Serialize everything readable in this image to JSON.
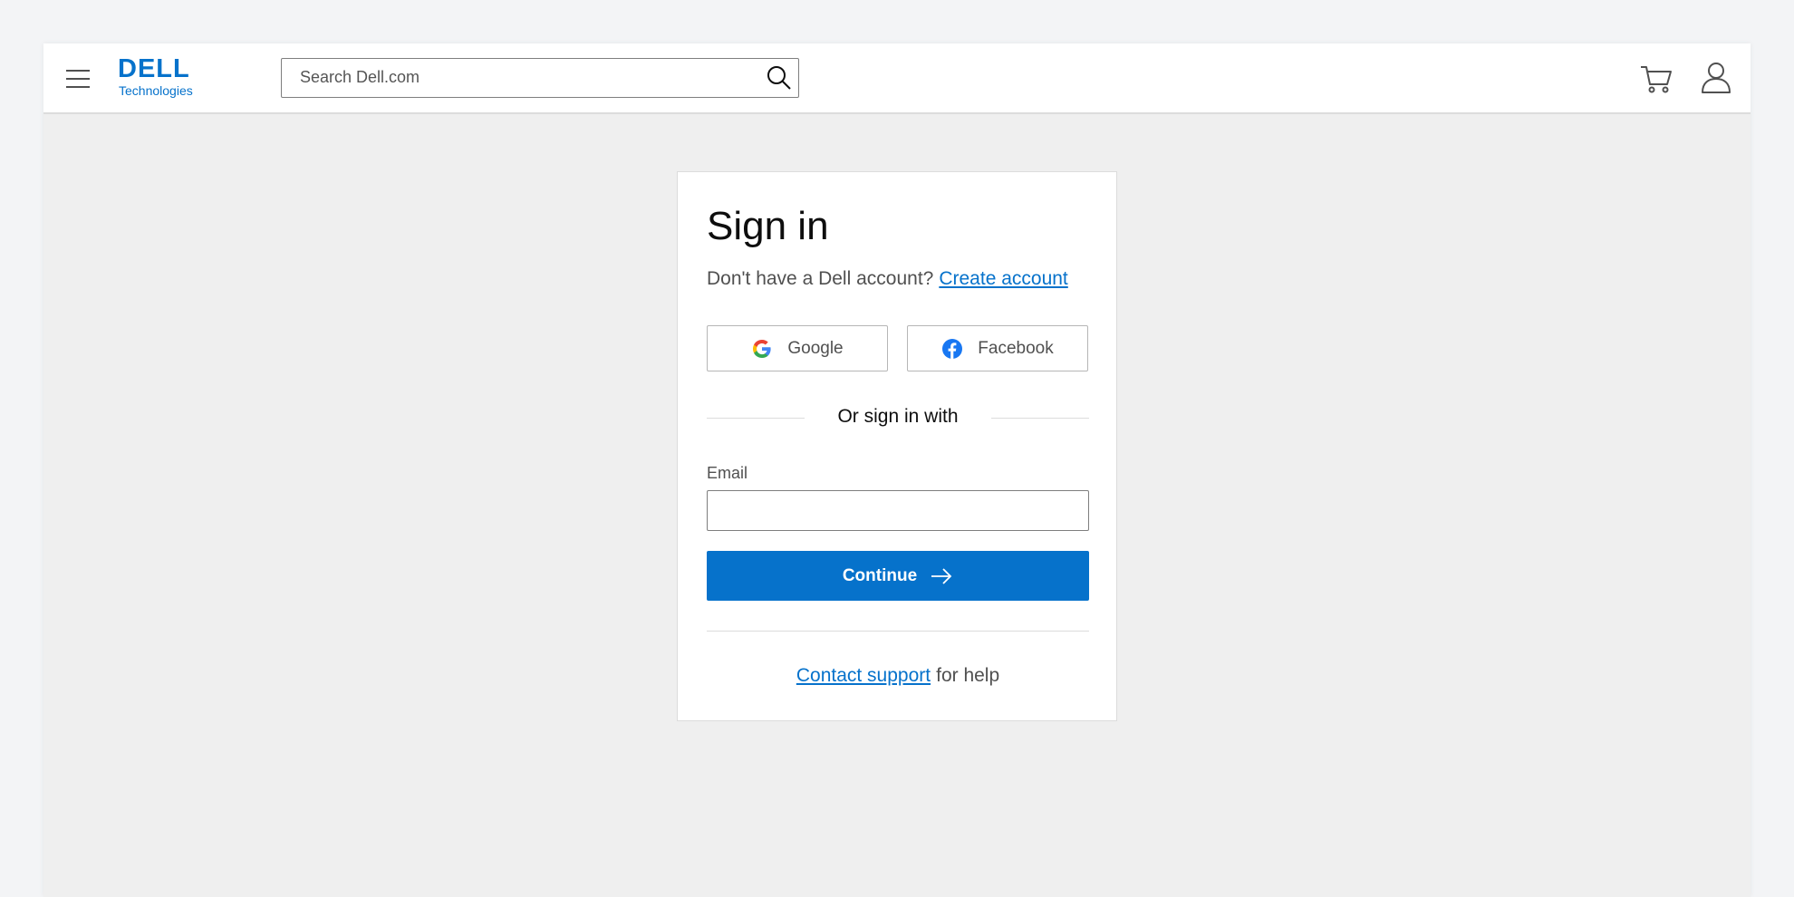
{
  "header": {
    "logo": {
      "word": "DELL",
      "sub": "Technologies"
    },
    "search": {
      "placeholder": "Search Dell.com",
      "value": ""
    },
    "icons": [
      "menu-icon",
      "search-icon",
      "cart-icon",
      "user-icon"
    ]
  },
  "signin": {
    "title": "Sign in",
    "no_account_text": "Don't have a Dell account?",
    "create_account_link": "Create account",
    "social": [
      {
        "label": "Google",
        "icon": "google-icon"
      },
      {
        "label": "Facebook",
        "icon": "facebook-icon"
      }
    ],
    "divider_text": "Or sign in with",
    "email_label": "Email",
    "email_value": "",
    "continue_label": "Continue",
    "contact_link": "Contact support",
    "help_suffix": "for help"
  },
  "colors": {
    "accent": "#0672cb",
    "page_bg": "#efefef",
    "card_bg": "#ffffff",
    "text_muted": "#505050"
  }
}
